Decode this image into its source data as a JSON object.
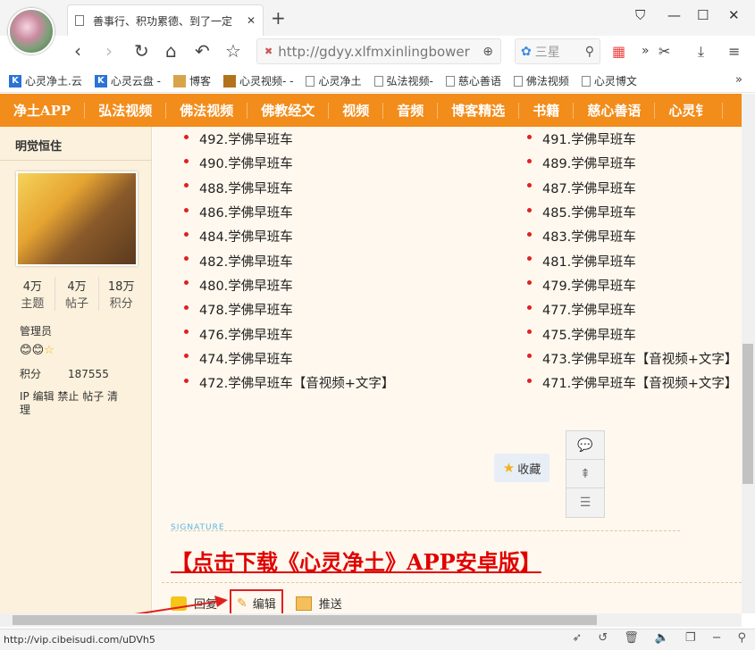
{
  "browser": {
    "tab_title": "善事行、积功累德、到了一定",
    "url": "http://gdyy.xlfmxinlingbower",
    "search_placeholder": "三星",
    "status_url": "http://vip.cibeisudi.com/uDVh5"
  },
  "bookmarks": [
    {
      "label": "心灵净土.云",
      "icon": "k-icon"
    },
    {
      "label": "心灵云盘 -",
      "icon": "k-icon"
    },
    {
      "label": "博客",
      "icon": "image-icon"
    },
    {
      "label": "心灵视频- -",
      "icon": "video-icon"
    },
    {
      "label": "心灵净土",
      "icon": "doc-icon"
    },
    {
      "label": "弘法视频-",
      "icon": "doc-icon"
    },
    {
      "label": "慈心善语",
      "icon": "doc-icon"
    },
    {
      "label": "佛法视频",
      "icon": "doc-icon"
    },
    {
      "label": "心灵博文",
      "icon": "doc-icon"
    }
  ],
  "menu": [
    "净土APP",
    "弘法视频",
    "佛法视频",
    "佛教经文",
    "视频",
    "音频",
    "博客精选",
    "书籍",
    "慈心善语",
    "心灵钅"
  ],
  "user": {
    "name": "明觉恒住",
    "stats": [
      {
        "value": "4万",
        "label": "主题"
      },
      {
        "value": "4万",
        "label": "帖子"
      },
      {
        "value": "18万",
        "label": "积分"
      }
    ],
    "role": "管理员",
    "score_label": "积分",
    "score_value": "187555",
    "admin_links": "IP 编辑 禁止 帖子 清理"
  },
  "posts_left": [
    "492.学佛早班车",
    "490.学佛早班车",
    "488.学佛早班车",
    "486.学佛早班车",
    "484.学佛早班车",
    "482.学佛早班车",
    "480.学佛早班车",
    "478.学佛早班车",
    "476.学佛早班车",
    "474.学佛早班车",
    "472.学佛早班车【音视频+文字】"
  ],
  "posts_right": [
    "491.学佛早班车",
    "489.学佛早班车",
    "487.学佛早班车",
    "485.学佛早班车",
    "483.学佛早班车",
    "481.学佛早班车",
    "479.学佛早班车",
    "477.学佛早班车",
    "475.学佛早班车",
    "473.学佛早班车【音视频+文字】",
    "471.学佛早班车【音视频+文字】"
  ],
  "favorite_label": "收藏",
  "signature": {
    "label": "SIGNATURE",
    "download_text": "【点击下载《心灵净土》APP安卓版】"
  },
  "actions": {
    "reply": "回复",
    "edit": "编辑",
    "push": "推送"
  },
  "colors": {
    "menu_bg": "#f28c1a",
    "highlight_red": "#e02020",
    "download_red": "#e00000",
    "sidebar_bg": "#fbf1dc"
  }
}
